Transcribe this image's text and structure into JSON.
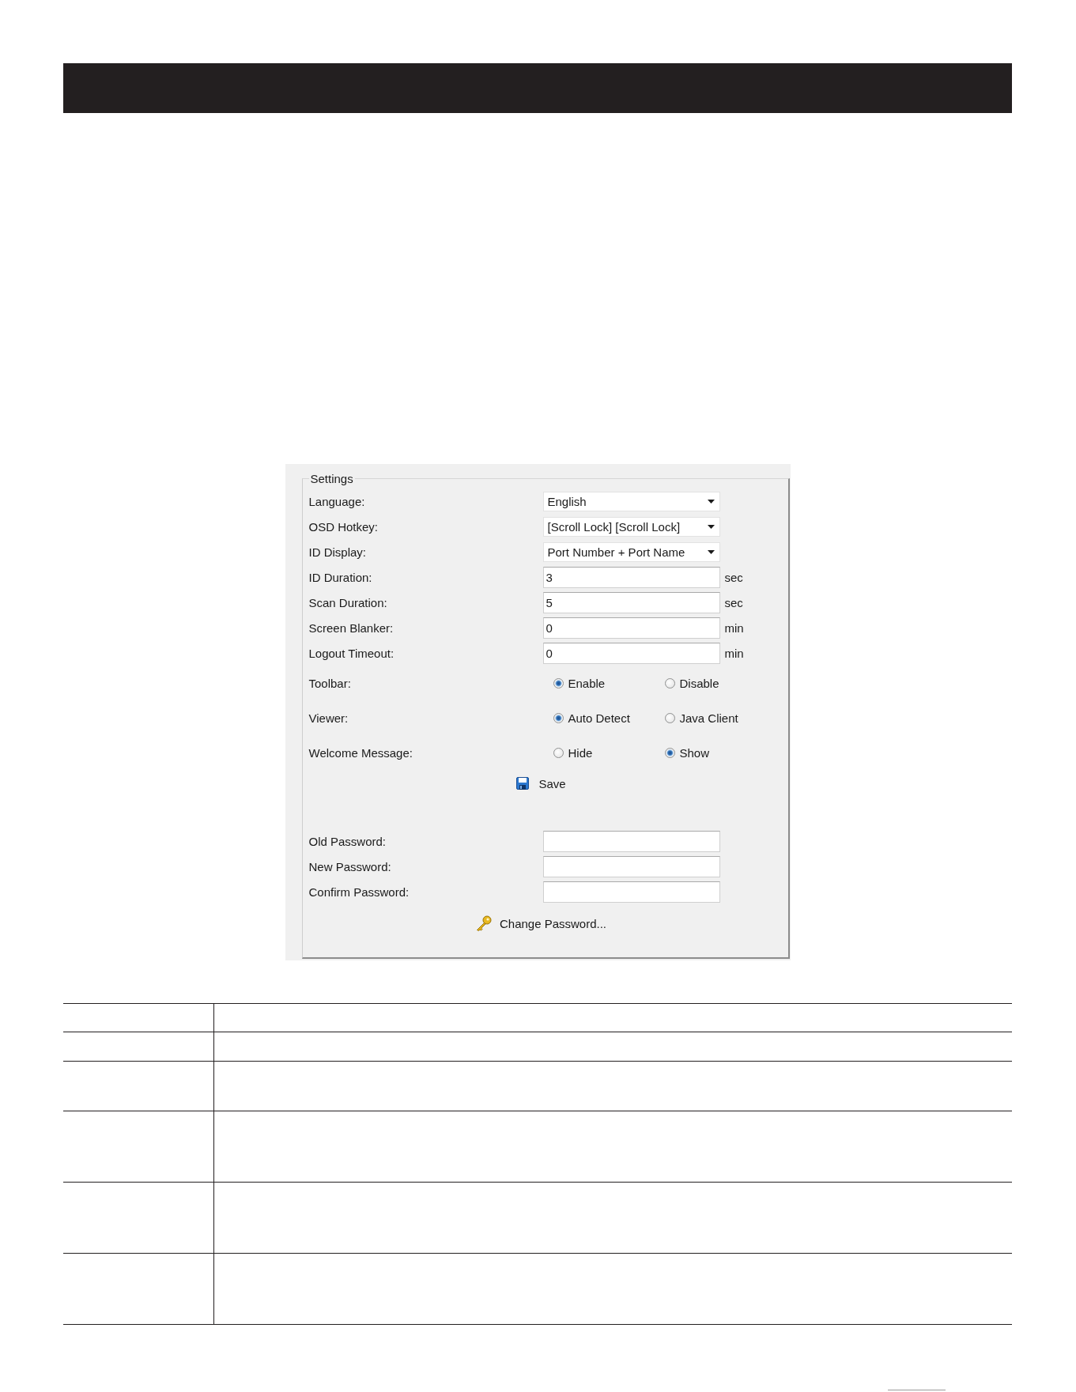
{
  "settings": {
    "title": "Settings",
    "fields": [
      {
        "kind": "dropdown",
        "label": "Language:",
        "value": "English"
      },
      {
        "kind": "dropdown",
        "label": "OSD Hotkey:",
        "value": "[Scroll Lock] [Scroll Lock]"
      },
      {
        "kind": "dropdown",
        "label": "ID Display:",
        "value": "Port Number + Port Name"
      },
      {
        "kind": "text",
        "label": "ID Duration:",
        "value": "3",
        "unit": "sec"
      },
      {
        "kind": "text",
        "label": "Scan Duration:",
        "value": "5",
        "unit": "sec"
      },
      {
        "kind": "text",
        "label": "Screen Blanker:",
        "value": "0",
        "unit": "min"
      },
      {
        "kind": "text",
        "label": "Logout Timeout:",
        "value": "0",
        "unit": "min"
      },
      {
        "kind": "radio",
        "label": "Toolbar:",
        "options": [
          {
            "label": "Enable",
            "selected": true
          },
          {
            "label": "Disable",
            "selected": false
          }
        ]
      },
      {
        "kind": "radio",
        "label": "Viewer:",
        "options": [
          {
            "label": "Auto Detect",
            "selected": true
          },
          {
            "label": "Java Client",
            "selected": false
          }
        ]
      },
      {
        "kind": "radio",
        "label": "Welcome Message:",
        "options": [
          {
            "label": "Hide",
            "selected": false
          },
          {
            "label": "Show",
            "selected": true
          }
        ]
      }
    ],
    "save_button": "Save",
    "password_fields": [
      {
        "label": "Old Password:"
      },
      {
        "label": "New Password:"
      },
      {
        "label": "Confirm Password:"
      }
    ],
    "change_password_button": "Change Password..."
  }
}
